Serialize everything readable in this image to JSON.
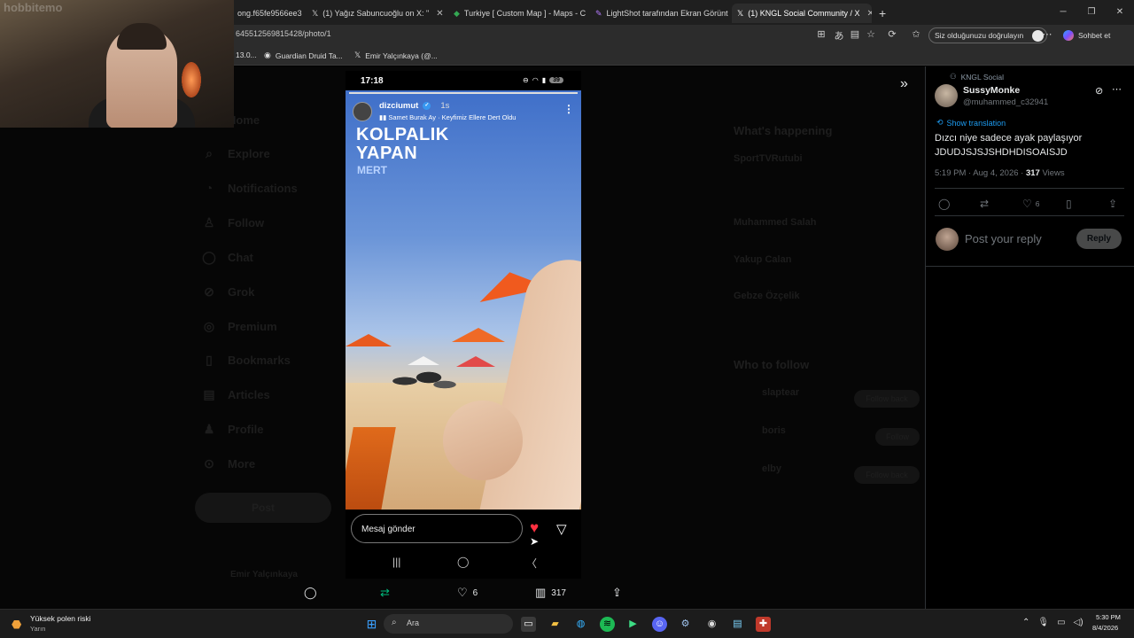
{
  "browser": {
    "tabs": [
      {
        "label": "ong.f65fe9566ee3",
        "icon": "page-icon"
      },
      {
        "label": "(1) Yağız Sabuncuoğlu on X: \"",
        "icon": "x-icon"
      },
      {
        "label": "Turkiye [ Custom Map ] - Maps - C",
        "icon": "map-icon"
      },
      {
        "label": "LightShot tarafından Ekran Görünt",
        "icon": "feather-icon"
      },
      {
        "label": "(1) KNGL Social Community / X",
        "icon": "x-icon"
      }
    ],
    "url": "645512569815428/photo/1",
    "bookmarks": [
      "13.0...",
      "Guardian Druid Ta...",
      "Emir Yalçınkaya (@..."
    ],
    "verify_label": "Siz olduğunuzu doğrulayın",
    "chat_label": "Sohbet et"
  },
  "webcam": {
    "overlay_text": "hobbitemo"
  },
  "x_nav": {
    "items": [
      "Home",
      "Explore",
      "Notifications",
      "Follow",
      "Chat",
      "Grok",
      "Premium",
      "Bookmarks",
      "Articles",
      "Profile",
      "More"
    ],
    "post_label": "Post",
    "account_name": "Emir Yalçınkaya"
  },
  "x_sidebar": {
    "whats_happening": "What's happening",
    "trends": [
      "SportTVRutubi",
      "Muhammed Salah",
      "Yakup Calan",
      "Gebze Özçelik"
    ],
    "who_to_follow": "Who to follow",
    "suggestions": [
      {
        "name": "slaptear",
        "button": "Follow back"
      },
      {
        "name": "boris",
        "button": "Follow"
      },
      {
        "name": "elby",
        "button": "Follow back"
      }
    ]
  },
  "story": {
    "time": "17:18",
    "battery": "39",
    "username": "dizciumut",
    "age": "1s",
    "music": "Samet Burak Ay · Keyfimiz Ellere Dert Oldu",
    "headline_line1": "KOLPALIK",
    "headline_line2": "YAPAN",
    "headline_sub": "MERT",
    "message_placeholder": "Mesaj gönder"
  },
  "actions": {
    "reply_icon": "comment-icon",
    "retweet_icon": "retweet-icon",
    "likes": "6",
    "views": "317",
    "share_icon": "share-icon"
  },
  "panel": {
    "community": "KNGL Social",
    "name": "SussyMonke",
    "handle": "@muhammed_c32941",
    "show_translation": "Show translation",
    "text": "Dızcı niye sadece ayak paylaşıyor JDUDJSJSJSHDHDISOAISJD",
    "time_date": "5:19 PM · Aug 4, 2026 · ",
    "views_count": "317",
    "views_label": " Views",
    "likes": "6",
    "reply_placeholder": "Post your reply",
    "reply_button": "Reply"
  },
  "taskbar": {
    "weather_title": "Yüksek polen riski",
    "weather_sub": "Yarın",
    "search_placeholder": "Ara",
    "clock_time": "5:30 PM",
    "clock_date": "8/4/2026"
  },
  "colors": {
    "accent": "#1d9bf0",
    "like": "#ff3040",
    "green": "#00ba7c"
  }
}
